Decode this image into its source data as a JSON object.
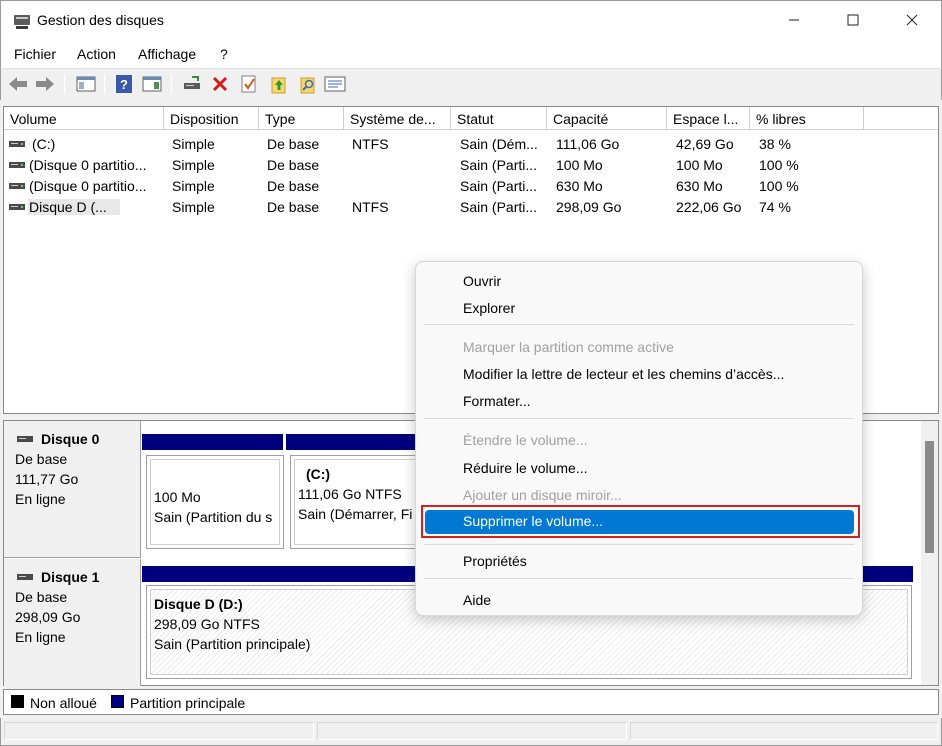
{
  "window": {
    "title": "Gestion des disques",
    "controls": {
      "minimize": "—",
      "maximize": "☐",
      "close": "✕"
    }
  },
  "menu": [
    "Fichier",
    "Action",
    "Affichage",
    "?"
  ],
  "toolbar_icons": [
    "back-arrow-icon",
    "forward-arrow-icon",
    "console-tree-icon",
    "help-icon",
    "properties-view-icon",
    "connect-drive-icon",
    "delete-icon",
    "check-icon",
    "folder-up-icon",
    "folder-search-icon",
    "list-view-icon"
  ],
  "volume_list": {
    "columns": [
      "Volume",
      "Disposition",
      "Type",
      "Système de...",
      "Statut",
      "Capacité",
      "Espace l...",
      "% libres"
    ],
    "rows": [
      [
        "(C:)",
        "Simple",
        "De base",
        "NTFS",
        "Sain (Dém...",
        "111,06 Go",
        "42,69 Go",
        "38 %"
      ],
      [
        "(Disque 0 partitio...",
        "Simple",
        "De base",
        "",
        "Sain (Parti...",
        "100 Mo",
        "100 Mo",
        "100 %"
      ],
      [
        "(Disque 0 partitio...",
        "Simple",
        "De base",
        "",
        "Sain (Parti...",
        "630 Mo",
        "630 Mo",
        "100 %"
      ],
      [
        "Disque D (...",
        "Simple",
        "De base",
        "NTFS",
        "Sain (Parti...",
        "298,09 Go",
        "222,06 Go",
        "74 %"
      ]
    ]
  },
  "disks": [
    {
      "name": "Disque 0",
      "type": "De base",
      "size": "111,77 Go",
      "state": "En ligne",
      "partitions": [
        {
          "title": "",
          "size": "100 Mo",
          "status": "Sain (Partition du s"
        },
        {
          "title": "(C:)",
          "size": "111,06 Go NTFS",
          "status": "Sain (Démarrer, Fi"
        }
      ]
    },
    {
      "name": "Disque 1",
      "type": "De base",
      "size": "298,09 Go",
      "state": "En ligne",
      "partitions": [
        {
          "title": "Disque D  (D:)",
          "size": "298,09 Go NTFS",
          "status": "Sain (Partition principale)"
        }
      ]
    }
  ],
  "legend": [
    {
      "label": "Non alloué",
      "color": "#000000"
    },
    {
      "label": "Partition principale",
      "color": "#00007f"
    }
  ],
  "context_menu": {
    "items": [
      {
        "label": "Ouvrir",
        "enabled": true
      },
      {
        "label": "Explorer",
        "enabled": true
      },
      {
        "label": "Marquer la partition comme active",
        "enabled": false
      },
      {
        "label": "Modifier la lettre de lecteur et les chemins d’accès...",
        "enabled": true
      },
      {
        "label": "Formater...",
        "enabled": true
      },
      {
        "label": "Étendre le volume...",
        "enabled": false
      },
      {
        "label": "Réduire le volume...",
        "enabled": true
      },
      {
        "label": "Ajouter un disque miroir...",
        "enabled": false
      },
      {
        "label": "Supprimer le volume...",
        "enabled": true,
        "highlighted": true
      },
      {
        "label": "Propriétés",
        "enabled": true
      },
      {
        "label": "Aide",
        "enabled": true
      }
    ],
    "highlight_color": "#0078d4",
    "annotation_color": "#d32020"
  }
}
